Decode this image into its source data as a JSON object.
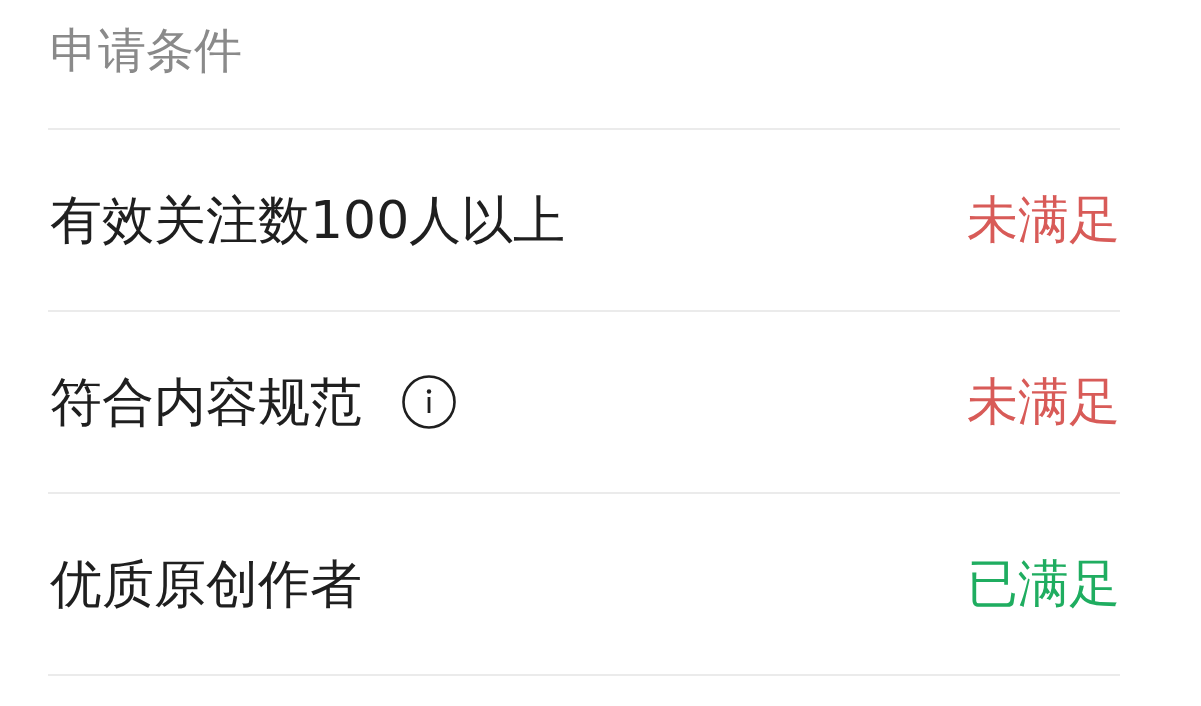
{
  "header": {
    "title": "申请条件"
  },
  "conditions": [
    {
      "label": "有效关注数100人以上",
      "info": false,
      "status": "未满足",
      "met": false
    },
    {
      "label": "符合内容规范",
      "info": true,
      "status": "未满足",
      "met": false
    },
    {
      "label": "优质原创作者",
      "info": false,
      "status": "已满足",
      "met": true
    }
  ]
}
